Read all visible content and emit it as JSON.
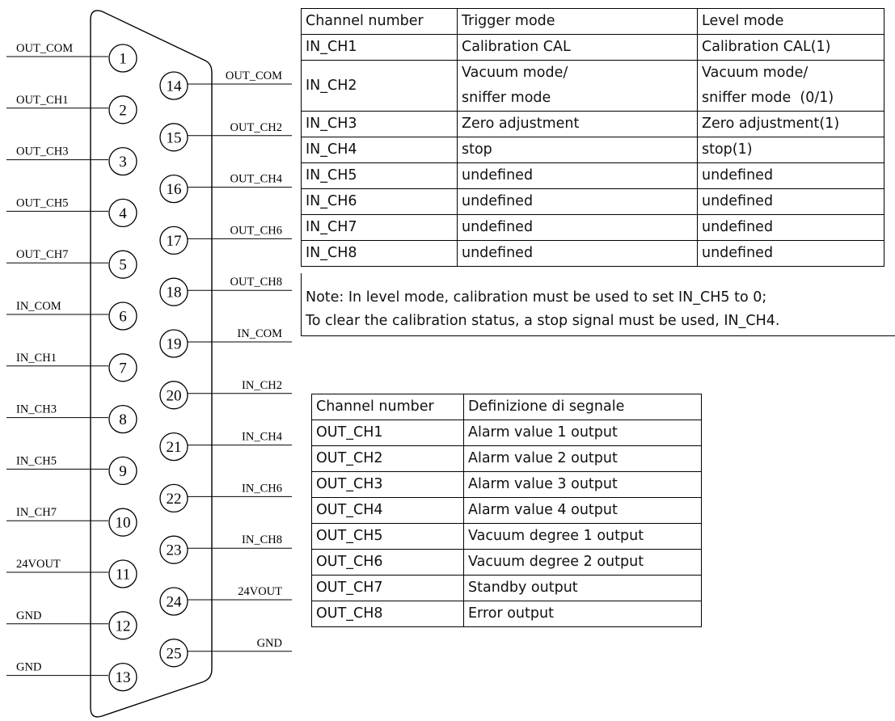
{
  "left_pins": [
    {
      "num": "1",
      "label": "OUT_COM"
    },
    {
      "num": "2",
      "label": "OUT_CH1"
    },
    {
      "num": "3",
      "label": "OUT_CH3"
    },
    {
      "num": "4",
      "label": "OUT_CH5"
    },
    {
      "num": "5",
      "label": "OUT_CH7"
    },
    {
      "num": "6",
      "label": "IN_COM"
    },
    {
      "num": "7",
      "label": "IN_CH1"
    },
    {
      "num": "8",
      "label": "IN_CH3"
    },
    {
      "num": "9",
      "label": "IN_CH5"
    },
    {
      "num": "10",
      "label": "IN_CH7"
    },
    {
      "num": "11",
      "label": "24VOUT"
    },
    {
      "num": "12",
      "label": "GND"
    },
    {
      "num": "13",
      "label": "GND"
    }
  ],
  "right_pins": [
    {
      "num": "14",
      "label": "OUT_COM"
    },
    {
      "num": "15",
      "label": "OUT_CH2"
    },
    {
      "num": "16",
      "label": "OUT_CH4"
    },
    {
      "num": "17",
      "label": "OUT_CH6"
    },
    {
      "num": "18",
      "label": "OUT_CH8"
    },
    {
      "num": "19",
      "label": "IN_COM"
    },
    {
      "num": "20",
      "label": "IN_CH2"
    },
    {
      "num": "21",
      "label": "IN_CH4"
    },
    {
      "num": "22",
      "label": "IN_CH6"
    },
    {
      "num": "23",
      "label": "IN_CH8"
    },
    {
      "num": "24",
      "label": "24VOUT"
    },
    {
      "num": "25",
      "label": "GND"
    }
  ],
  "input_table": {
    "headers": [
      "Channel number",
      "Trigger mode",
      "Level mode"
    ],
    "rows": [
      {
        "channel": "IN_CH1",
        "trigger": [
          "Calibration CAL"
        ],
        "level": [
          "Calibration CAL(1)"
        ]
      },
      {
        "channel": "IN_CH2",
        "trigger": [
          "Vacuum mode/",
          "sniffer mode"
        ],
        "level": [
          "Vacuum mode/",
          "sniffer mode  (0/1)"
        ]
      },
      {
        "channel": "IN_CH3",
        "trigger": [
          "Zero adjustment"
        ],
        "level": [
          "Zero adjustment(1)"
        ]
      },
      {
        "channel": "IN_CH4",
        "trigger": [
          "stop"
        ],
        "level": [
          "stop(1)"
        ]
      },
      {
        "channel": "IN_CH5",
        "trigger": [
          "undefined"
        ],
        "level": [
          "undefined"
        ]
      },
      {
        "channel": "IN_CH6",
        "trigger": [
          "undefined"
        ],
        "level": [
          "undefined"
        ]
      },
      {
        "channel": "IN_CH7",
        "trigger": [
          "undefined"
        ],
        "level": [
          "undefined"
        ]
      },
      {
        "channel": "IN_CH8",
        "trigger": [
          "undefined"
        ],
        "level": [
          "undefined"
        ]
      }
    ]
  },
  "note": {
    "line1": "Note:  In level mode, calibration must be used to set IN_CH5 to 0;",
    "line2": "To clear the calibration status, a stop signal must be used, IN_CH4."
  },
  "output_table": {
    "headers": [
      "Channel number",
      "Definizione di segnale"
    ],
    "rows": [
      {
        "channel": "OUT_CH1",
        "signal": "Alarm value 1 output"
      },
      {
        "channel": "OUT_CH2",
        "signal": "Alarm value 2 output"
      },
      {
        "channel": "OUT_CH3",
        "signal": "Alarm value 3 output"
      },
      {
        "channel": "OUT_CH4",
        "signal": "Alarm value 4 output"
      },
      {
        "channel": "OUT_CH5",
        "signal": "Vacuum degree 1 output"
      },
      {
        "channel": "OUT_CH6",
        "signal": "Vacuum degree 2 output"
      },
      {
        "channel": "OUT_CH7",
        "signal": "Standby output"
      },
      {
        "channel": "OUT_CH8",
        "signal": "Error output"
      }
    ]
  }
}
